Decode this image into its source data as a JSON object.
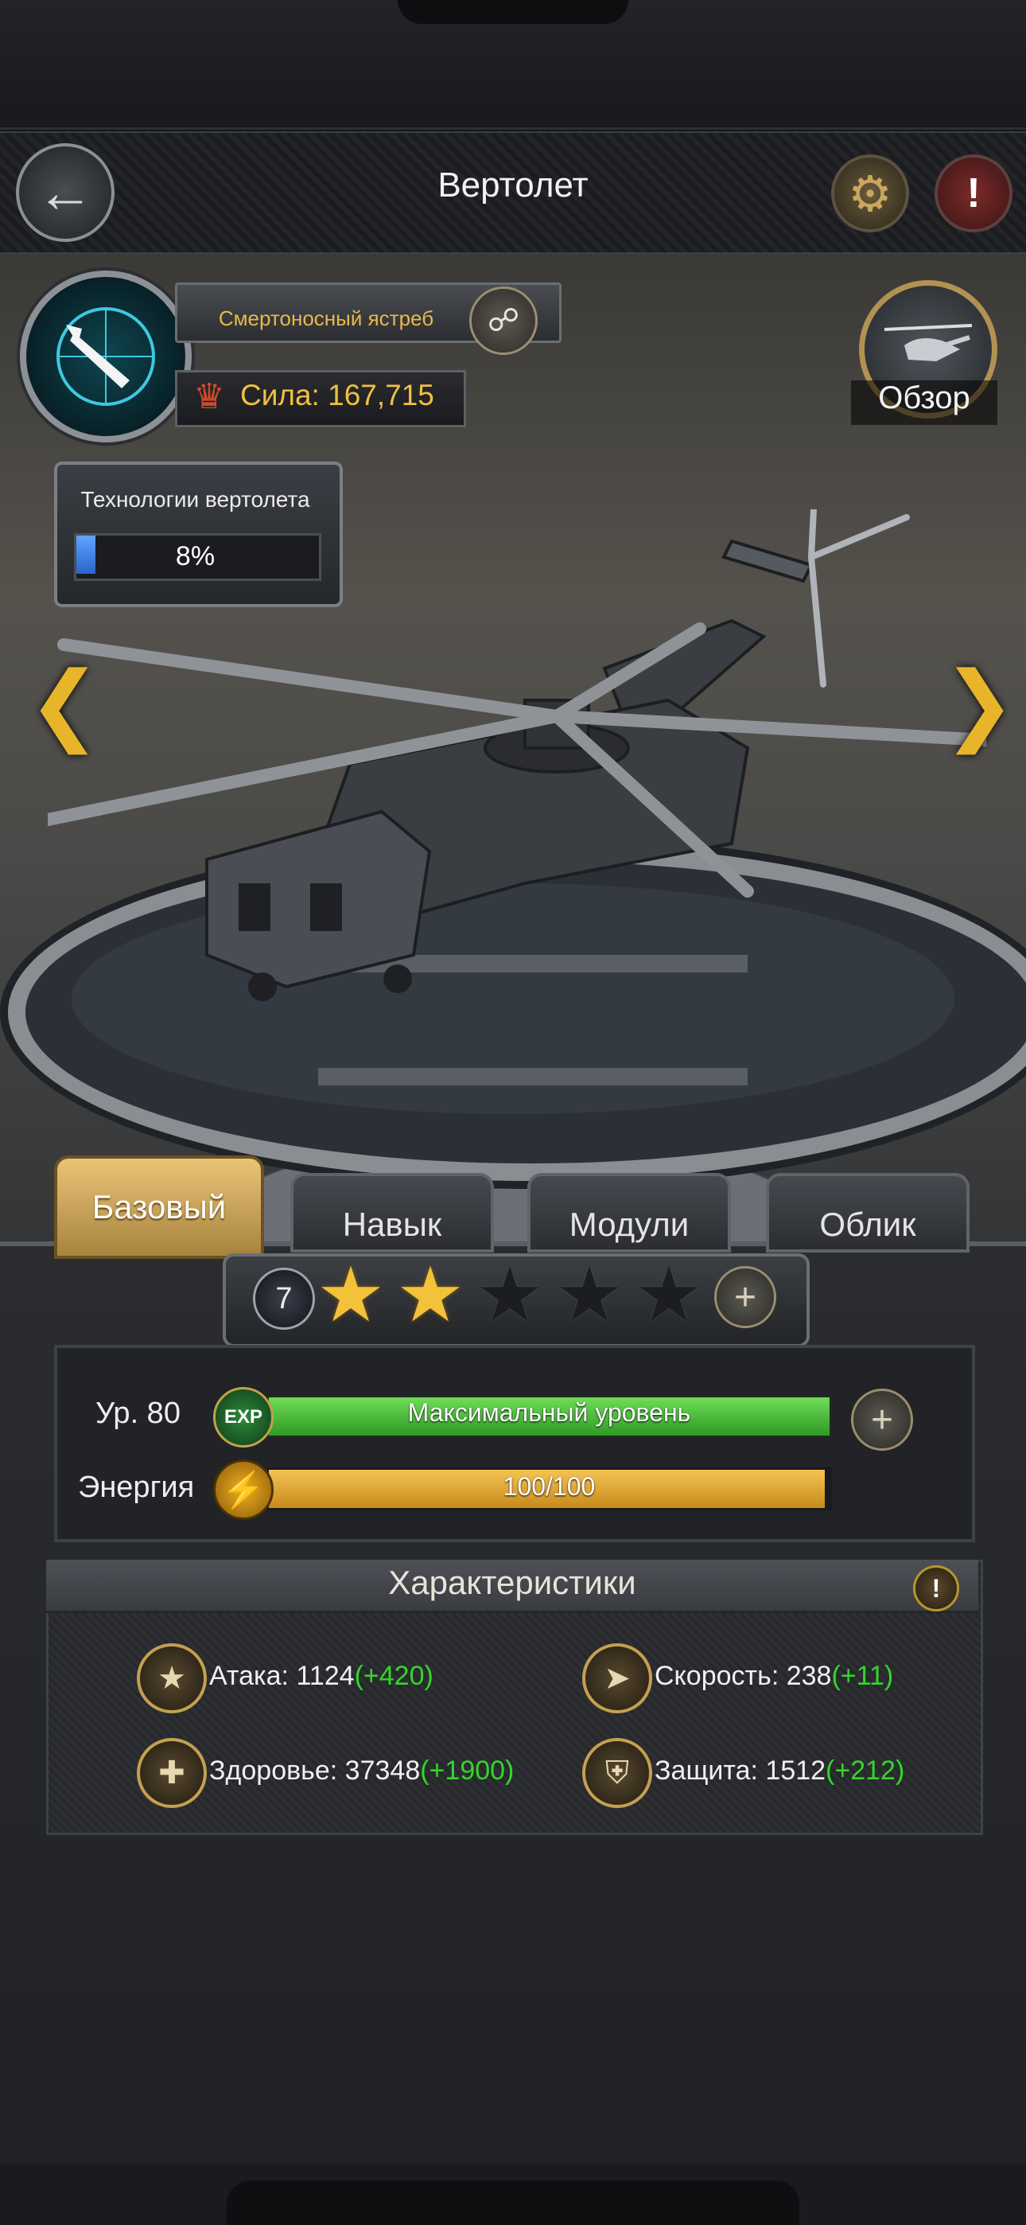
{
  "header": {
    "title": "Вертолет"
  },
  "unit": {
    "name": "Смертоносный ястреб",
    "power": "Сила: 167,715",
    "review_label": "Обзор"
  },
  "tech": {
    "label": "Технологии вертолета",
    "percent_text": "8%",
    "progress": 0.08
  },
  "tabs": [
    {
      "label": "Базовый",
      "active": true
    },
    {
      "label": "Навык",
      "active": false
    },
    {
      "label": "Модули",
      "active": false
    },
    {
      "label": "Облик",
      "active": false
    }
  ],
  "stars": {
    "level": "7",
    "filled": 2,
    "total": 5
  },
  "level": {
    "label": "Ур. 80",
    "exp_icon": "EXP",
    "exp_text": "Максимальный уровень",
    "exp_progress": 1.0
  },
  "energy": {
    "label": "Энергия",
    "value_text": "100/100",
    "progress": 1.0
  },
  "stats": {
    "title": "Характеристики",
    "items": [
      {
        "label": "Атака: 1124",
        "bonus": "(+420)",
        "icon": "pistol-icon"
      },
      {
        "label": "Скорость: 238",
        "bonus": "(+11)",
        "icon": "speed-icon"
      },
      {
        "label": "Здоровье: 37348",
        "bonus": "(+1900)",
        "icon": "health-icon"
      },
      {
        "label": "Защита: 1512",
        "bonus": "(+212)",
        "icon": "shield-icon"
      }
    ]
  },
  "colors": {
    "accent_gold": "#e8b84a",
    "bonus_green": "#35d52a",
    "exp_green": "#4cc63a",
    "energy_gold": "#e4aa3a"
  }
}
